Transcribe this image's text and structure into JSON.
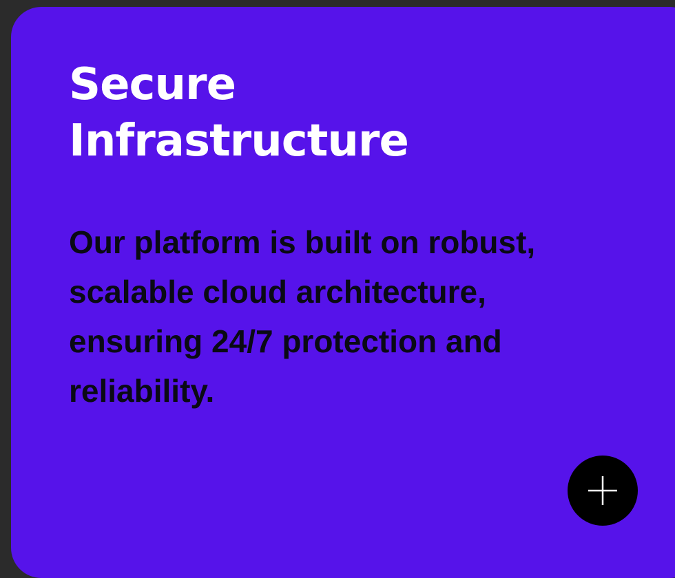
{
  "card": {
    "title_line1": "Secure",
    "title_line2": "Infrastructure",
    "body": "Our platform is built on robust, scalable cloud architecture, ensuring 24/7 protection and reliability.",
    "expand_icon": "plus-icon",
    "colors": {
      "background": "#5613ea",
      "title": "#ffffff",
      "body": "#0a0a14",
      "button": "#000000",
      "page": "#2b2b2b"
    }
  }
}
